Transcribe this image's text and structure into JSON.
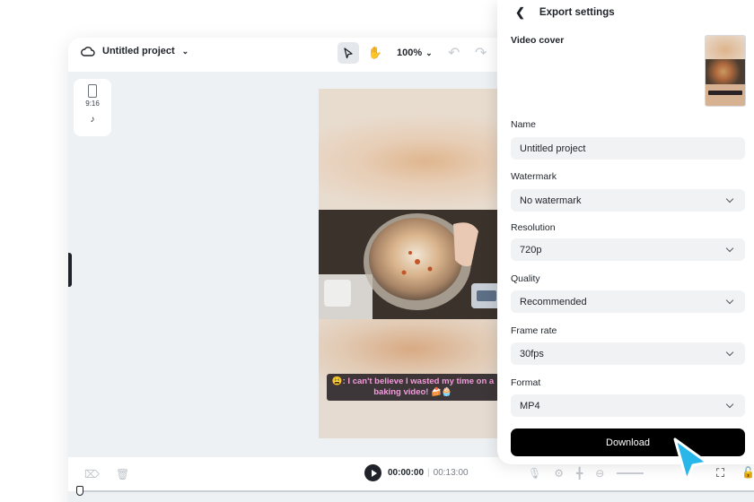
{
  "editor": {
    "project_name": "Untitled project",
    "zoom": "100%",
    "aspect_ratio": "9:16",
    "platform_icon": "tiktok-icon"
  },
  "preview": {
    "caption": "😩: I can't believe I wasted my time on a baking video! 🍰🧁"
  },
  "playback": {
    "current_time": "00:00:00",
    "separator": "|",
    "duration": "00:13:00"
  },
  "export_panel": {
    "title": "Export settings",
    "video_cover_label": "Video cover",
    "name_label": "Name",
    "name_value": "Untitled project",
    "watermark_label": "Watermark",
    "watermark_value": "No watermark",
    "resolution_label": "Resolution",
    "resolution_value": "720p",
    "quality_label": "Quality",
    "quality_value": "Recommended",
    "frame_rate_label": "Frame rate",
    "frame_rate_value": "30fps",
    "format_label": "Format",
    "format_value": "MP4",
    "download_label": "Download"
  },
  "colors": {
    "accent_cursor": "#29b6e8",
    "download_bg": "#000000",
    "caption_text": "#f39bdc"
  }
}
